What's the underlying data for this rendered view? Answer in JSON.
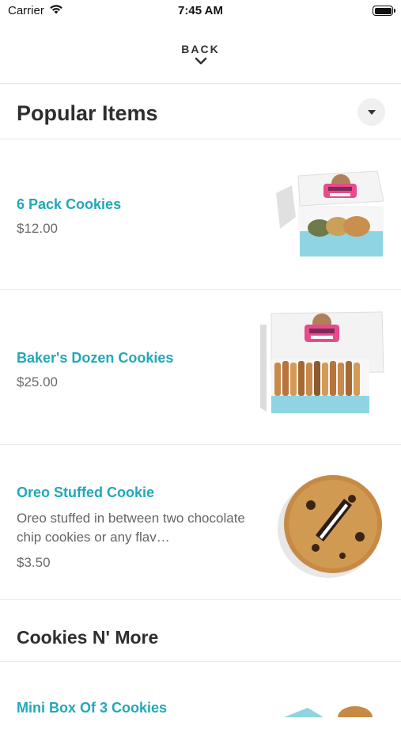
{
  "status": {
    "carrier": "Carrier",
    "time": "7:45 AM"
  },
  "nav": {
    "back_label": "BACK"
  },
  "section1": {
    "title": "Popular Items"
  },
  "items": [
    {
      "name": "6 Pack Cookies",
      "price": "$12.00"
    },
    {
      "name": "Baker's Dozen Cookies",
      "price": "$25.00"
    },
    {
      "name": "Oreo Stuffed Cookie",
      "description": "Oreo stuffed in between two chocolate chip cookies or any flav…",
      "price": "$3.50"
    },
    {
      "name": "Mini Box Of 3 Cookies"
    }
  ],
  "section2": {
    "title": "Cookies N' More"
  },
  "colors": {
    "accent": "#22a8b6",
    "box_blue": "#8fd4e3",
    "brand_pink": "#e84a8a"
  }
}
